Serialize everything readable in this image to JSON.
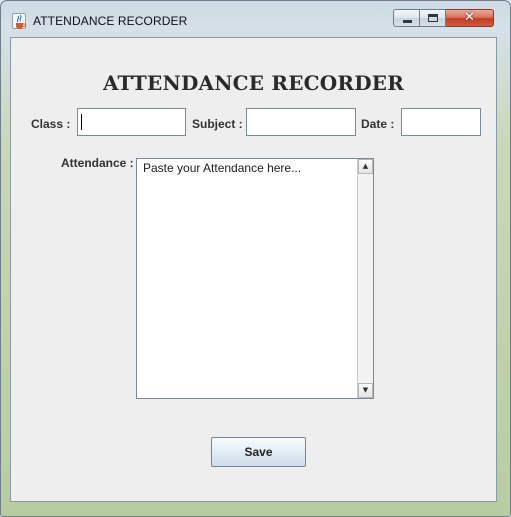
{
  "window": {
    "title": "ATTENDANCE RECORDER",
    "app_icon": "java-coffee-icon",
    "controls": {
      "minimize_icon": "minimize-icon",
      "maximize_icon": "maximize-icon",
      "close_icon": "close-icon",
      "close_glyph": "✕"
    }
  },
  "form": {
    "heading": "ATTENDANCE RECORDER",
    "class_label": "Class :",
    "class_value": "",
    "subject_label": "Subject :",
    "subject_value": "",
    "date_label": "Date :",
    "date_value": "",
    "attendance_label": "Attendance :",
    "attendance_text": "Paste your Attendance here...",
    "scroll_up": "▲",
    "scroll_down": "▼",
    "save_label": "Save"
  },
  "colors": {
    "client_bg": "#eeeeee",
    "close_button": "#c23d24",
    "frame_green": "#b8cca0"
  }
}
